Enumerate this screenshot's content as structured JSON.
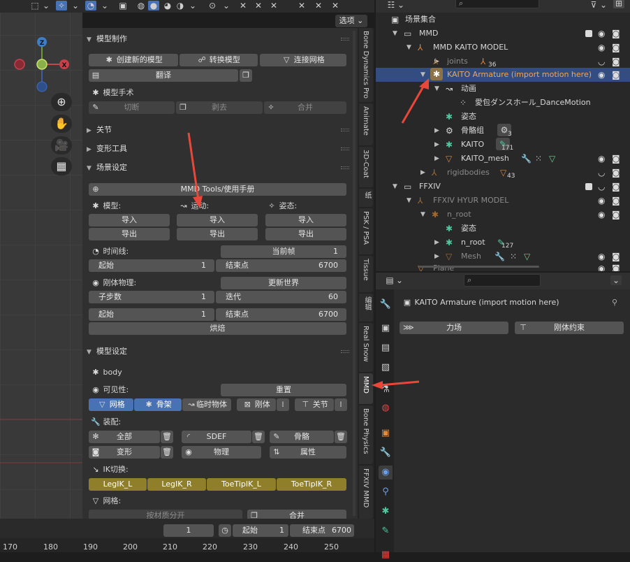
{
  "header": {
    "mode_label": "选项"
  },
  "sidebar_tabs": [
    "Bone Dynamics Pro",
    "Animate",
    "3D-Coat",
    "纸",
    "PSK / PSA",
    "Tissue",
    "编辑",
    "Real Snow",
    "MMD",
    "Bone Physics",
    "FFXIV MMD"
  ],
  "gizmo": {
    "z": "Z",
    "x": "X"
  },
  "model_production": {
    "title": "模型制作",
    "create_model": "创建新的模型",
    "convert_model": "转换模型",
    "attach_meshes": "连接网格",
    "translate": "翻译",
    "surgery_title": "模型手术",
    "cut": "切断",
    "peel": "剥去",
    "merge": "合并"
  },
  "collapsed": {
    "joints": "关节",
    "deform_tools": "变形工具"
  },
  "scene_setup": {
    "title": "场景设定",
    "manual": "MMD Tools/使用手册",
    "model_label": "模型:",
    "motion_label": "运动:",
    "pose_label": "姿态:",
    "import": "导入",
    "export": "导出",
    "timeline_label": "时间线:",
    "current_frame": "当前帧",
    "current_frame_value": "1",
    "start": "起始",
    "start_value": "1",
    "end": "结束点",
    "end_value": "6700",
    "rigid_label": "刚体物理:",
    "update_world": "更新世界",
    "substeps": "子步数",
    "substeps_value": "1",
    "iterations": "迭代",
    "iterations_value": "60",
    "start2_value": "1",
    "end2_value": "6700",
    "bake": "烘焙"
  },
  "model_setup": {
    "title": "模型设定",
    "model_name": "body",
    "visibility_label": "可见性:",
    "reset": "重置",
    "mesh": "网格",
    "armature": "骨架",
    "temp_objects": "临时物体",
    "rigid": "刚体",
    "joint": "关节",
    "assembly_label": "装配:",
    "all": "全部",
    "sdef": "SDEF",
    "bone": "骨骼",
    "morph": "变形",
    "physics": "物理",
    "property": "属性",
    "ik_label": "IK切换:",
    "ik_items": [
      "LegIK_L",
      "LegIK_R",
      "ToeTipIK_L",
      "ToeTipIK_R"
    ],
    "mesh_label": "网格:",
    "sep_by_material": "按材质分开",
    "join": "合并"
  },
  "timeline": {
    "frame": "1",
    "start_label": "起始",
    "start_value": "1",
    "end_label": "结束点",
    "end_value": "6700",
    "ticks": [
      "170",
      "180",
      "190",
      "200",
      "210",
      "220",
      "230",
      "240",
      "250"
    ]
  },
  "outliner": {
    "rows": [
      {
        "name": "场景集合"
      },
      {
        "name": "MMD"
      },
      {
        "name": "MMD KAITO MODEL"
      },
      {
        "name": "joints",
        "count": "36"
      },
      {
        "name": "KAITO Armature (import motion here)"
      },
      {
        "name": "动画"
      },
      {
        "name": "愛包ダンスホール_DanceMotion"
      },
      {
        "name": "姿态"
      },
      {
        "name": "骨骼组",
        "count": "3"
      },
      {
        "name": "KAITO",
        "count": "171"
      },
      {
        "name": "KAITO_mesh"
      },
      {
        "name": "rigidbodies",
        "count": "43"
      },
      {
        "name": "FFXIV"
      },
      {
        "name": "FFXIV HYUR MODEL"
      },
      {
        "name": "n_root"
      },
      {
        "name": "姿态"
      },
      {
        "name": "n_root",
        "count": "127"
      },
      {
        "name": "Mesh"
      },
      {
        "name": "Plane"
      }
    ]
  },
  "properties": {
    "object_name": "KAITO Armature (import motion here)",
    "field": "力场",
    "rigid_constraint": "刚体约束"
  },
  "colors": {
    "accent": "#4772b3",
    "selected_row": "#334d80",
    "ik_yellow": "#8f7f2b",
    "arrow": "#e8473a"
  }
}
